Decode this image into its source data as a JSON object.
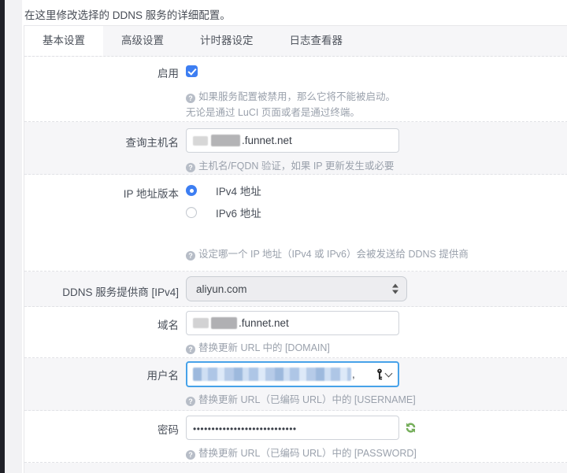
{
  "page": {
    "description": "在这里修改选择的 DDNS 服务的详细配置。"
  },
  "tabs": [
    {
      "label": "基本设置",
      "active": true
    },
    {
      "label": "高级设置",
      "active": false
    },
    {
      "label": "计时器设定",
      "active": false
    },
    {
      "label": "日志查看器",
      "active": false
    }
  ],
  "icons": {
    "help_glyph": "?",
    "key_icon": "password-manager-key",
    "refresh_icon": "toggle-password-refresh"
  },
  "colors": {
    "accent_blue": "#3d7ef2",
    "focus_border": "#47a2e9",
    "refresh_green": "#76b259",
    "zebra_gray": "#f6f6f8",
    "edge_dark": "#202128"
  },
  "fields": {
    "enable": {
      "label": "启用",
      "checked": true,
      "help_line1": "如果服务配置被禁用，那么它将不能被启动。",
      "help_line2": "无论是通过 LuCI 页面或者是通过终端。"
    },
    "lookup_host": {
      "label": "查询主机名",
      "value_redacted": true,
      "value_suffix": ".funnet.net",
      "help": "主机名/FQDN 验证，如果 IP 更新发生或必要"
    },
    "ip_version": {
      "label": "IP 地址版本",
      "options": [
        "IPv4 地址",
        "IPv6 地址"
      ],
      "selected": "IPv4 地址",
      "help": "设定哪一个 IP 地址（IPv4 或 IPv6）会被发送给 DDNS 提供商"
    },
    "provider": {
      "label": "DDNS 服务提供商 [IPv4]",
      "value": "aliyun.com"
    },
    "domain": {
      "label": "域名",
      "value_redacted": true,
      "value_suffix": ".funnet.net",
      "help": "替换更新 URL 中的 [DOMAIN]"
    },
    "username": {
      "label": "用户名",
      "value_redacted": true,
      "visible_tail": ",",
      "focused": true,
      "help": "替换更新 URL（已编码 URL）中的 [USERNAME]"
    },
    "password": {
      "label": "密码",
      "value_masked": "••••••••••••••••••••••••••••",
      "help": "替换更新 URL（已编码 URL）中的 [PASSWORD]"
    }
  }
}
